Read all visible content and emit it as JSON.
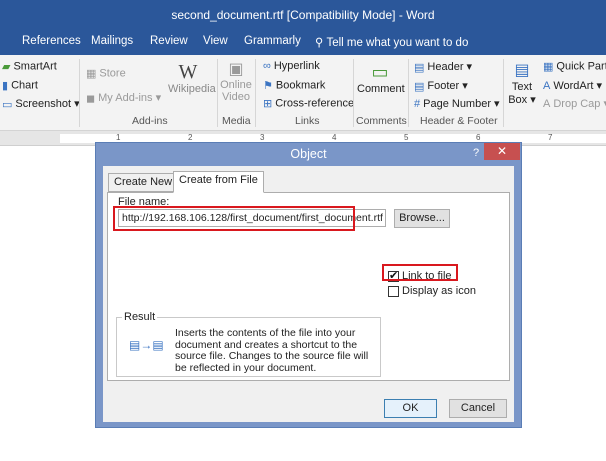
{
  "window": {
    "title": "second_document.rtf [Compatibility Mode] - Word"
  },
  "ribbon_tabs": [
    "References",
    "Mailings",
    "Review",
    "View",
    "Grammarly"
  ],
  "tell_me": "Tell me what you want to do",
  "ribbon": {
    "illustrations": {
      "smartart": "SmartArt",
      "chart": "Chart",
      "screenshot": "Screenshot"
    },
    "addins": {
      "store": "Store",
      "my_addins": "My Add-ins",
      "wikipedia": "Wikipedia",
      "label": "Add-ins"
    },
    "media": {
      "online_video_line1": "Online",
      "online_video_line2": "Video",
      "label": "Media"
    },
    "links": {
      "hyperlink": "Hyperlink",
      "bookmark": "Bookmark",
      "cross_reference": "Cross-reference",
      "label": "Links"
    },
    "comments": {
      "comment": "Comment",
      "label": "Comments"
    },
    "header_footer": {
      "header": "Header",
      "footer": "Footer",
      "page_number": "Page Number",
      "label": "Header & Footer"
    },
    "text": {
      "text_box_line1": "Text",
      "text_box_line2": "Box",
      "quick_parts": "Quick Parts",
      "wordart": "WordArt",
      "drop_cap": "Drop Cap"
    }
  },
  "ruler": {
    "marks": [
      "1",
      "2",
      "3",
      "4",
      "5",
      "6",
      "7"
    ]
  },
  "dialog": {
    "title": "Object",
    "help": "?",
    "close": "✕",
    "tabs": [
      "Create New",
      "Create from File"
    ],
    "file_name_label": "File name:",
    "file_name_value": "http://192.168.106.128/first_document/first_document.rtf",
    "browse_label": "Browse...",
    "link_to_file_label": "Link to file",
    "link_to_file_checked": true,
    "display_as_icon_label": "Display as icon",
    "display_as_icon_checked": false,
    "result_title": "Result",
    "result_text": "Inserts the contents of the file into your document and creates a shortcut to the source file.  Changes to the source file will be reflected in your document.",
    "ok_label": "OK",
    "cancel_label": "Cancel"
  },
  "colors": {
    "title_bar": "#2b579a",
    "highlight": "#d9181e",
    "dialog_frame": "#7a96c8"
  }
}
